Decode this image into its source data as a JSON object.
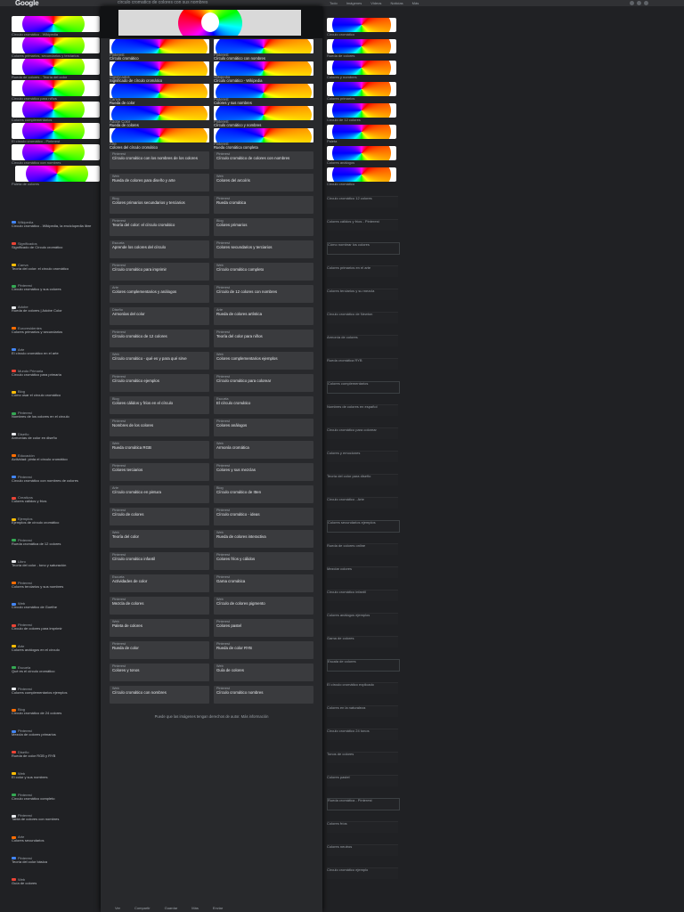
{
  "header": {
    "logo": "Google",
    "query": "circulo cromatico de colores con sus nombres",
    "filters": [
      "Todo",
      "Imágenes",
      "Videos",
      "Noticias",
      "Más"
    ]
  },
  "colors": {
    "background": "#202124",
    "panel": "#28292c",
    "card": "#3a3b3e",
    "text": "#e8eaed",
    "muted": "#9aa0a6",
    "link": "#8ab4f8"
  },
  "left_thumbnails": [
    {
      "caption": "Círculo cromático - Wikipedia"
    },
    {
      "caption": "Colores primarios, secundarios y terciarios"
    },
    {
      "caption": "Rueda de colores - Teoría del color"
    },
    {
      "caption": "Círculo cromático para niños"
    },
    {
      "caption": "Colores complementarios"
    },
    {
      "caption": "El círculo cromático - Pinterest"
    },
    {
      "caption": "Círculo cromático con nombres"
    },
    {
      "caption": "Paleta de colores"
    }
  ],
  "left_results": [
    {
      "source": "Wikipedia",
      "title": "Círculo cromático - Wikipedia, la enciclopedia libre"
    },
    {
      "source": "Significados",
      "title": "Significado de Círculo cromático"
    },
    {
      "source": "Canva",
      "title": "Teoría del color: el círculo cromático"
    },
    {
      "source": "Pinterest",
      "title": "Círculo cromático y sus colores"
    },
    {
      "source": "Adobe",
      "title": "Rueda de colores | Adobe Color"
    },
    {
      "source": "Euroresidentes",
      "title": "Colores primarios y secundarios"
    },
    {
      "source": "Arte",
      "title": "El círculo cromático en el arte"
    },
    {
      "source": "Mundo Primaria",
      "title": "Círculo cromático para primaria"
    },
    {
      "source": "Blog",
      "title": "Cómo usar el círculo cromático"
    },
    {
      "source": "Pinterest",
      "title": "Nombres de los colores en el círculo"
    },
    {
      "source": "Diseño",
      "title": "Armonías de color en diseño"
    },
    {
      "source": "Educación",
      "title": "Actividad: pinta el círculo cromático"
    },
    {
      "source": "Pinterest",
      "title": "Círculo cromático con nombres de colores"
    },
    {
      "source": "Creativos",
      "title": "Colores cálidos y fríos"
    },
    {
      "source": "Ejemplos",
      "title": "Ejemplos de círculo cromático"
    },
    {
      "source": "Pinterest",
      "title": "Rueda cromática de 12 colores"
    },
    {
      "source": "Libro",
      "title": "Teoría del color - tono y saturación"
    },
    {
      "source": "Pinterest",
      "title": "Colores terciarios y sus nombres"
    },
    {
      "source": "Web",
      "title": "Círculo cromático de Goethe"
    },
    {
      "source": "Pinterest",
      "title": "Círculo de colores para imprimir"
    },
    {
      "source": "Arte",
      "title": "Colores análogos en el círculo"
    },
    {
      "source": "Escuela",
      "title": "Qué es el círculo cromático"
    },
    {
      "source": "Pinterest",
      "title": "Colores complementarios ejemplos"
    },
    {
      "source": "Blog",
      "title": "Círculo cromático de 24 colores"
    },
    {
      "source": "Pinterest",
      "title": "Mezcla de colores primarios"
    },
    {
      "source": "Diseño",
      "title": "Rueda de color RGB y RYB"
    },
    {
      "source": "Web",
      "title": "El color y sus nombres"
    },
    {
      "source": "Pinterest",
      "title": "Círculo cromático completo"
    },
    {
      "source": "Pinterest",
      "title": "Tabla de colores con nombres"
    },
    {
      "source": "Arte",
      "title": "Colores secundarios"
    },
    {
      "source": "Pinterest",
      "title": "Teoría del color básica"
    },
    {
      "source": "Web",
      "title": "Guía de colores"
    }
  ],
  "right_thumbnails": [
    {
      "caption": "Círculo cromático"
    },
    {
      "caption": "Rueda de colores"
    },
    {
      "caption": "Colores y nombres"
    },
    {
      "caption": "Colores primarios"
    },
    {
      "caption": "Círculo de 12 colores"
    },
    {
      "caption": "Paleta"
    },
    {
      "caption": "Colores análogos"
    },
    {
      "caption": "Círculo cromático"
    }
  ],
  "right_results": [
    {
      "title": "Círculo cromático 12 colores"
    },
    {
      "title": "Colores cálidos y fríos - Pinterest"
    },
    {
      "title": "Cómo nombrar los colores"
    },
    {
      "title": "Colores primarios en el arte"
    },
    {
      "title": "Colores terciarios y su mezcla"
    },
    {
      "title": "Círculo cromático de Newton"
    },
    {
      "title": "Armonía de colores"
    },
    {
      "title": "Rueda cromática RYB"
    },
    {
      "title": "Colores complementarios"
    },
    {
      "title": "Nombres de colores en español"
    },
    {
      "title": "Círculo cromático para colorear"
    },
    {
      "title": "Colores y emociones"
    },
    {
      "title": "Teoría del color para diseño"
    },
    {
      "title": "Círculo cromático - Arte"
    },
    {
      "title": "Colores secundarios ejemplos"
    },
    {
      "title": "Rueda de colores online"
    },
    {
      "title": "Mezclar colores"
    },
    {
      "title": "Círculo cromático infantil"
    },
    {
      "title": "Colores análogos ejemplos"
    },
    {
      "title": "Gama de colores"
    },
    {
      "title": "Escala de colores"
    },
    {
      "title": "El círculo cromático explicado"
    },
    {
      "title": "Colores en la naturaleza"
    },
    {
      "title": "Círculo cromático 24 tonos"
    },
    {
      "title": "Tonos de colores"
    },
    {
      "title": "Colores pastel"
    },
    {
      "title": "Rueda cromática - Pinterest"
    },
    {
      "title": "Colores fríos"
    },
    {
      "title": "Colores neutros"
    },
    {
      "title": "Círculo cromático ejemplo"
    }
  ],
  "panel": {
    "image_cards": [
      {
        "source": "Pinterest",
        "title": "Círculo cromático"
      },
      {
        "source": "Pinterest",
        "title": "Círculo cromático con nombres"
      },
      {
        "source": "Significados",
        "title": "Significado de círculo cromático"
      },
      {
        "source": "Wikipedia",
        "title": "Círculo cromático - Wikipedia"
      },
      {
        "source": "Canva",
        "title": "Rueda de color"
      },
      {
        "source": "Pinterest",
        "title": "Colores y sus nombres"
      },
      {
        "source": "Adobe Color",
        "title": "Rueda de colores"
      },
      {
        "source": "Pinterest",
        "title": "Círculo cromático y nombres"
      },
      {
        "source": "Arte",
        "title": "Colores del círculo cromático"
      },
      {
        "source": "Pinterest",
        "title": "Rueda cromática completa"
      }
    ],
    "text_cards_left": [
      {
        "source": "Pinterest",
        "title": "Círculo cromático con los nombres de los colores"
      },
      {
        "source": "Web",
        "title": "Rueda de colores para diseño y arte"
      },
      {
        "source": "Blog",
        "title": "Colores primarios secundarios y terciarios"
      },
      {
        "source": "Pinterest",
        "title": "Teoría del color: el círculo cromático"
      },
      {
        "source": "Escuela",
        "title": "Aprende los colores del círculo"
      },
      {
        "source": "Pinterest",
        "title": "Círculo cromático para imprimir"
      },
      {
        "source": "Arte",
        "title": "Colores complementarios y análogos"
      },
      {
        "source": "Diseño",
        "title": "Armonías del color"
      },
      {
        "source": "Pinterest",
        "title": "Círculo cromático de 12 colores"
      },
      {
        "source": "Web",
        "title": "Círculo cromático - qué es y para qué sirve"
      },
      {
        "source": "Pinterest",
        "title": "Círculo cromático ejemplos"
      },
      {
        "source": "Blog",
        "title": "Colores cálidos y fríos en el círculo"
      },
      {
        "source": "Pinterest",
        "title": "Nombres de los colores"
      },
      {
        "source": "Web",
        "title": "Rueda cromática RGB"
      },
      {
        "source": "Pinterest",
        "title": "Colores terciarios"
      },
      {
        "source": "Arte",
        "title": "Círculo cromático en pintura"
      },
      {
        "source": "Pinterest",
        "title": "Círculo de colores"
      },
      {
        "source": "Web",
        "title": "Teoría del color"
      },
      {
        "source": "Pinterest",
        "title": "Círculo cromático infantil"
      },
      {
        "source": "Escuela",
        "title": "Actividades de color"
      },
      {
        "source": "Pinterest",
        "title": "Mezcla de colores"
      },
      {
        "source": "Web",
        "title": "Paleta de colores"
      },
      {
        "source": "Pinterest",
        "title": "Rueda de color"
      },
      {
        "source": "Pinterest",
        "title": "Colores y tonos"
      },
      {
        "source": "Web",
        "title": "Círculo cromático con nombres"
      }
    ],
    "text_cards_right": [
      {
        "source": "Pinterest",
        "title": "Círculo cromático de colores con nombres"
      },
      {
        "source": "Web",
        "title": "Colores del arcoíris"
      },
      {
        "source": "Pinterest",
        "title": "Rueda cromática"
      },
      {
        "source": "Blog",
        "title": "Colores primarios"
      },
      {
        "source": "Pinterest",
        "title": "Colores secundarios y terciarios"
      },
      {
        "source": "Web",
        "title": "Círculo cromático completo"
      },
      {
        "source": "Pinterest",
        "title": "Círculo de 12 colores con nombres"
      },
      {
        "source": "Arte",
        "title": "Rueda de colores artística"
      },
      {
        "source": "Pinterest",
        "title": "Teoría del color para niños"
      },
      {
        "source": "Web",
        "title": "Colores complementarios ejemplos"
      },
      {
        "source": "Pinterest",
        "title": "Círculo cromático para colorear"
      },
      {
        "source": "Escuela",
        "title": "El círculo cromático"
      },
      {
        "source": "Pinterest",
        "title": "Colores análogos"
      },
      {
        "source": "Web",
        "title": "Armonía cromática"
      },
      {
        "source": "Pinterest",
        "title": "Colores y sus mezclas"
      },
      {
        "source": "Blog",
        "title": "Círculo cromático de Itten"
      },
      {
        "source": "Pinterest",
        "title": "Círculo cromático - ideas"
      },
      {
        "source": "Web",
        "title": "Rueda de colores interactiva"
      },
      {
        "source": "Pinterest",
        "title": "Colores fríos y cálidos"
      },
      {
        "source": "Pinterest",
        "title": "Gama cromática"
      },
      {
        "source": "Web",
        "title": "Círculo de colores pigmento"
      },
      {
        "source": "Pinterest",
        "title": "Colores pastel"
      },
      {
        "source": "Pinterest",
        "title": "Rueda de color RYB"
      },
      {
        "source": "Web",
        "title": "Guía de colores"
      },
      {
        "source": "Pinterest",
        "title": "Círculo cromático nombres"
      }
    ],
    "footer_note": "Puede que las imágenes tengan derechos de autor. Más información",
    "bottom_bar": [
      "Ver",
      "Compartir",
      "Guardar",
      "Más",
      "Enviar"
    ]
  }
}
